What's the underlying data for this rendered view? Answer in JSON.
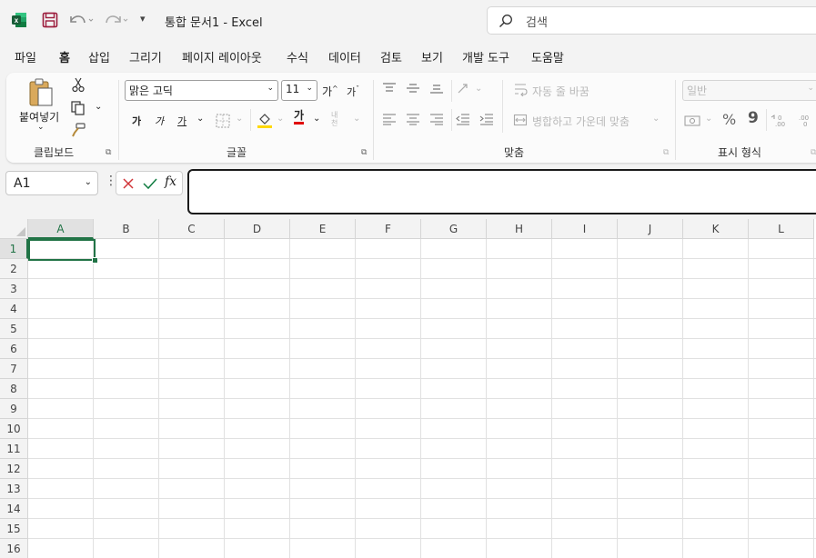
{
  "titlebar": {
    "doc_title": "통합 문서1  -  Excel",
    "search_placeholder": "검색",
    "qat_more": "▾"
  },
  "menu": {
    "tabs": [
      "파일",
      "홈",
      "삽입",
      "그리기",
      "페이지 레이아웃",
      "수식",
      "데이터",
      "검토",
      "보기",
      "개발 도구",
      "도움말"
    ],
    "active": "홈"
  },
  "ribbon": {
    "clipboard": {
      "paste_label": "붙여넣기",
      "group_label": "클립보드"
    },
    "font": {
      "font_name": "맑은 고딕",
      "font_size": "11",
      "grow": "가",
      "shrink": "가",
      "bold": "가",
      "italic": "가",
      "underline": "가",
      "font_color": "가",
      "phonetic": "내천",
      "group_label": "글꼴",
      "font_color_hex": "#e00000",
      "fill_color_hex": "#ffd800"
    },
    "alignment": {
      "wrap_text": "자동 줄 바꿈",
      "merge_center": "병합하고 가운데 맞춤",
      "group_label": "맞춤"
    },
    "number": {
      "format": "일반",
      "percent": "%",
      "comma": "9",
      "group_label": "표시 형식"
    }
  },
  "formula_bar": {
    "name_box": "A1",
    "fx": "fx",
    "formula": ""
  },
  "sheet": {
    "columns": [
      "A",
      "B",
      "C",
      "D",
      "E",
      "F",
      "G",
      "H",
      "I",
      "J",
      "K",
      "L"
    ],
    "rows": [
      "1",
      "2",
      "3",
      "4",
      "5",
      "6",
      "7",
      "8",
      "9",
      "10",
      "11",
      "12",
      "13",
      "14",
      "15",
      "16"
    ],
    "selected": "A1",
    "accent": "#217346"
  }
}
